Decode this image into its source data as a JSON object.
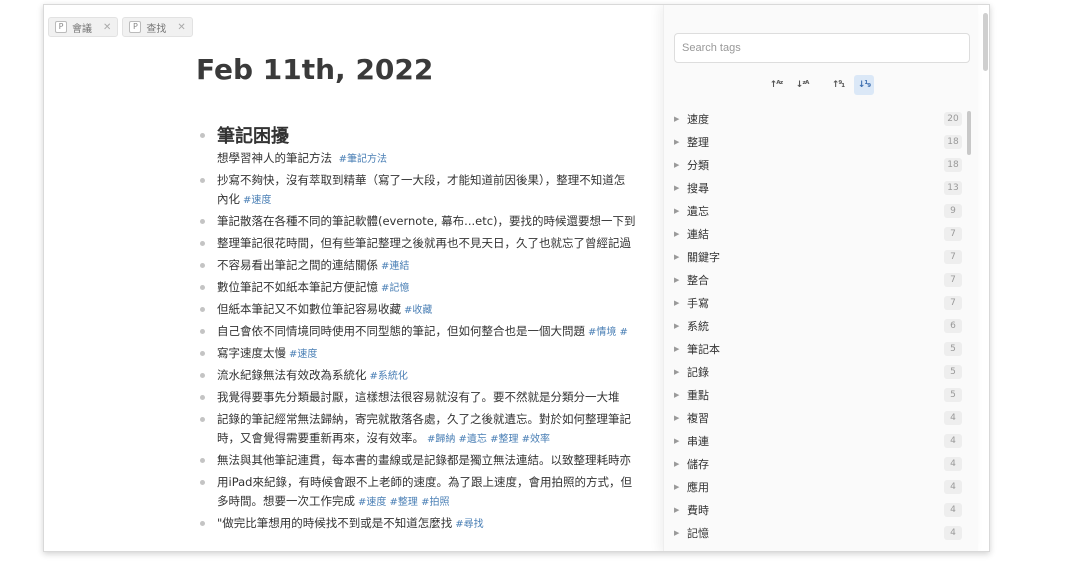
{
  "tabs": [
    {
      "badge": "P",
      "label": "會議"
    },
    {
      "badge": "P",
      "label": "查找"
    }
  ],
  "page": {
    "title": "Feb 11th, 2022",
    "heading": "筆記困擾",
    "heading_note": "想學習神人的筆記方法",
    "heading_note_tag": "#筆記方法",
    "blocks": [
      {
        "text": "抄寫不夠快，沒有萃取到精華（寫了一大段，才能知道前因後果），整理不知道怎",
        "line2": "內化",
        "tags": "#速度"
      },
      {
        "text": "筆記散落在各種不同的筆記軟體(evernote, 幕布...etc)，要找的時候還要想一下到",
        "line2": "",
        "tags": ""
      },
      {
        "text": "整理筆記很花時間，但有些筆記整理之後就再也不見天日，久了也就忘了曾經記過",
        "line2": "",
        "tags": ""
      },
      {
        "text": "不容易看出筆記之間的連結關係",
        "line2": "",
        "tags": "#連結"
      },
      {
        "text": "數位筆記不如紙本筆記方便記憶",
        "line2": "",
        "tags": "#記憶"
      },
      {
        "text": "但紙本筆記又不如數位筆記容易收藏",
        "line2": "",
        "tags": "#收藏"
      },
      {
        "text": "自己會依不同情境同時使用不同型態的筆記，但如何整合也是一個大問題",
        "line2": "",
        "tags": "#情境 #"
      },
      {
        "text": "寫字速度太慢",
        "line2": "",
        "tags": "#速度"
      },
      {
        "text": "流水紀錄無法有效改為系統化",
        "line2": "",
        "tags": "#系統化"
      },
      {
        "text": "我覺得要事先分類最討厭，這樣想法很容易就沒有了。要不然就是分類分一大堆",
        "line2": "",
        "tags": ""
      },
      {
        "text": "記錄的筆記經常無法歸納，寄完就散落各處，久了之後就遺忘。對於如何整理筆記",
        "line2": "時，又會覺得需要重新再來，沒有效率。",
        "tags": "#歸納 #遺忘 #整理 #效率"
      },
      {
        "text": "無法與其他筆記連貫，每本書的畫線或是記錄都是獨立無法連結。以致整理耗時亦",
        "line2": "",
        "tags": ""
      },
      {
        "text": "用iPad來紀錄，有時候會跟不上老師的速度。為了跟上速度，會用拍照的方式，但",
        "line2": "多時間。想要一次工作完成",
        "tags": "#速度 #整理 #拍照"
      },
      {
        "text": "\"做完比筆想用的時候找不到或是不知道怎麼找",
        "line2": "",
        "tags": "#尋找"
      }
    ]
  },
  "tag_panel": {
    "search_placeholder": "Search tags",
    "sort_buttons": [
      {
        "label": "↑ᴬᶻ",
        "icon": "sort-alpha-asc-icon",
        "active": false
      },
      {
        "label": "↓ᶻᴬ",
        "icon": "sort-alpha-desc-icon",
        "active": false
      },
      {
        "label": "↑⁹₁",
        "icon": "sort-count-asc-icon",
        "active": false
      },
      {
        "label": "↓¹₉",
        "icon": "sort-count-desc-icon",
        "active": true
      }
    ],
    "tags": [
      {
        "name": "速度",
        "count": "20"
      },
      {
        "name": "整理",
        "count": "18"
      },
      {
        "name": "分類",
        "count": "18"
      },
      {
        "name": "搜尋",
        "count": "13"
      },
      {
        "name": "遺忘",
        "count": "9"
      },
      {
        "name": "連結",
        "count": "7"
      },
      {
        "name": "關鍵字",
        "count": "7"
      },
      {
        "name": "整合",
        "count": "7"
      },
      {
        "name": "手寫",
        "count": "7"
      },
      {
        "name": "系統",
        "count": "6"
      },
      {
        "name": "筆記本",
        "count": "5"
      },
      {
        "name": "記錄",
        "count": "5"
      },
      {
        "name": "重點",
        "count": "5"
      },
      {
        "name": "複習",
        "count": "4"
      },
      {
        "name": "串連",
        "count": "4"
      },
      {
        "name": "儲存",
        "count": "4"
      },
      {
        "name": "應用",
        "count": "4"
      },
      {
        "name": "費時",
        "count": "4"
      },
      {
        "name": "記憶",
        "count": "4"
      }
    ]
  },
  "colors": {
    "tag_link": "#4a7fb5",
    "active_sort": "#dbe8f7"
  }
}
